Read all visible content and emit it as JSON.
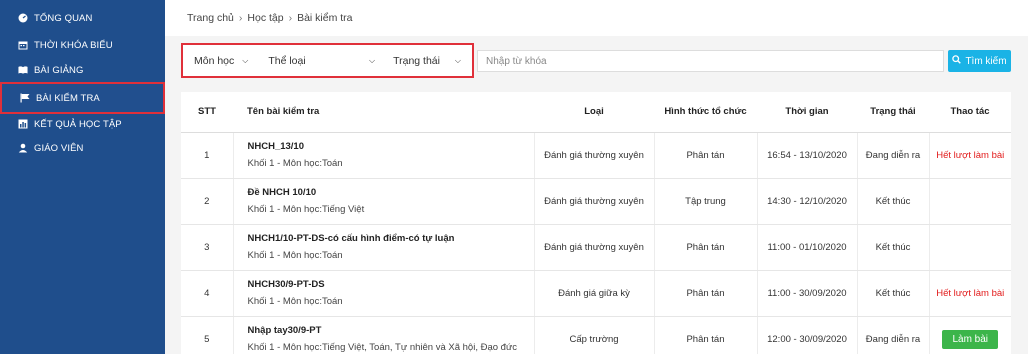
{
  "sidebar": {
    "items": [
      {
        "label": "Tổng quan",
        "icon": "dashboard-icon"
      },
      {
        "label": "Thời khóa biểu",
        "icon": "calendar-icon"
      },
      {
        "label": "Bài giảng",
        "icon": "book-icon"
      },
      {
        "label": "Bài kiểm tra",
        "icon": "flag-icon",
        "active": true
      },
      {
        "label": "Kết quả học tập",
        "icon": "chart-icon"
      },
      {
        "label": "Giáo viên",
        "icon": "user-icon"
      }
    ]
  },
  "breadcrumb": [
    "Trang chủ",
    "Học tập",
    "Bài kiểm tra"
  ],
  "filters": {
    "subject": "Môn học",
    "category": "Thể loại",
    "status": "Trạng thái"
  },
  "search": {
    "placeholder": "Nhập từ khóa",
    "button_label": "Tìm kiếm"
  },
  "table": {
    "headers": [
      "STT",
      "Tên bài kiểm tra",
      "Loại",
      "Hình thức tổ chức",
      "Thời gian",
      "Trạng thái",
      "Thao tác"
    ],
    "rows": [
      {
        "stt": "1",
        "name": "NHCH_13/10",
        "detail": "Khối 1 - Môn học:Toán",
        "type": "Đánh giá thường xuyên",
        "form": "Phân tán",
        "time": "16:54 - 13/10/2020",
        "status": "Đang diễn ra",
        "action": "Hết lượt làm bài",
        "action_kind": "text-red"
      },
      {
        "stt": "2",
        "name": "Đề NHCH 10/10",
        "detail": "Khối 1 - Môn học:Tiếng Việt",
        "type": "Đánh giá thường xuyên",
        "form": "Tập trung",
        "time": "14:30 - 12/10/2020",
        "status": "Kết thúc",
        "action": "",
        "action_kind": "none"
      },
      {
        "stt": "3",
        "name": "NHCH1/10-PT-DS-có cấu hình điểm-có tự luận",
        "detail": "Khối 1 - Môn học:Toán",
        "type": "Đánh giá thường xuyên",
        "form": "Phân tán",
        "time": "11:00 - 01/10/2020",
        "status": "Kết thúc",
        "action": "",
        "action_kind": "none"
      },
      {
        "stt": "4",
        "name": "NHCH30/9-PT-DS",
        "detail": "Khối 1 - Môn học:Toán",
        "type": "Đánh giá giữa kỳ",
        "form": "Phân tán",
        "time": "11:00 - 30/09/2020",
        "status": "Kết thúc",
        "action": "Hết lượt làm bài",
        "action_kind": "text-red"
      },
      {
        "stt": "5",
        "name": "Nhập tay30/9-PT",
        "detail": "Khối 1 - Môn học:Tiếng Việt, Toán, Tự nhiên và Xã hội, Đạo đức",
        "type": "Cấp trường",
        "form": "Phân tán",
        "time": "12:00 - 30/09/2020",
        "status": "Đang diễn ra",
        "action": "Làm bài",
        "action_kind": "button-green"
      }
    ]
  }
}
